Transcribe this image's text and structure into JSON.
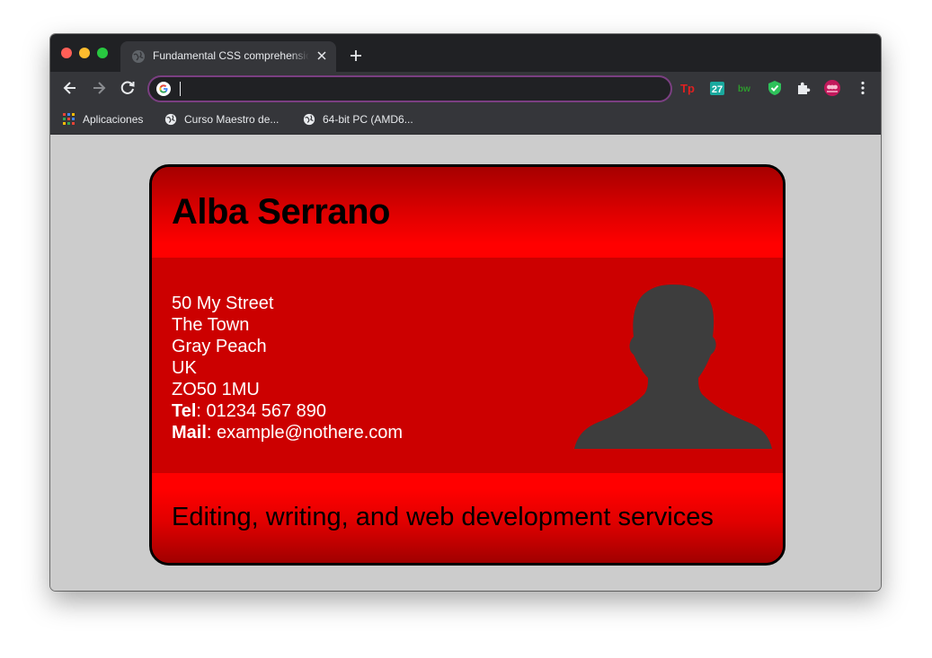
{
  "browser": {
    "tab_title": "Fundamental CSS comprehension",
    "omnibox_value": "",
    "bookmarks": [
      {
        "label": "Aplicaciones",
        "icon": "apps-grid-icon"
      },
      {
        "label": "Curso Maestro de...",
        "icon": "globe-icon"
      },
      {
        "label": "64-bit PC (AMD6...",
        "icon": "globe-icon"
      }
    ],
    "extensions": [
      "tp-icon",
      "calendar-27-icon",
      "bw-icon",
      "shield-check-icon",
      "puzzle-icon",
      "profile-avatar-icon"
    ],
    "calendar_number": "27",
    "tp_label": "Tp",
    "bw_label": "bw"
  },
  "card": {
    "name": "Alba Serrano",
    "address_lines": [
      "50 My Street",
      "The Town",
      "Gray Peach",
      "UK",
      "ZO50 1MU"
    ],
    "tel_label": "Tel",
    "tel_value": ": 01234 567 890",
    "mail_label": "Mail",
    "mail_value": ": example@nothere.com",
    "tagline": "Editing, writing, and web development services"
  },
  "colors": {
    "card_red": "#cc0000",
    "header_bright_red": "#ff0000",
    "page_bg": "#cccccc",
    "avatar_gray": "#3d3d3d"
  }
}
